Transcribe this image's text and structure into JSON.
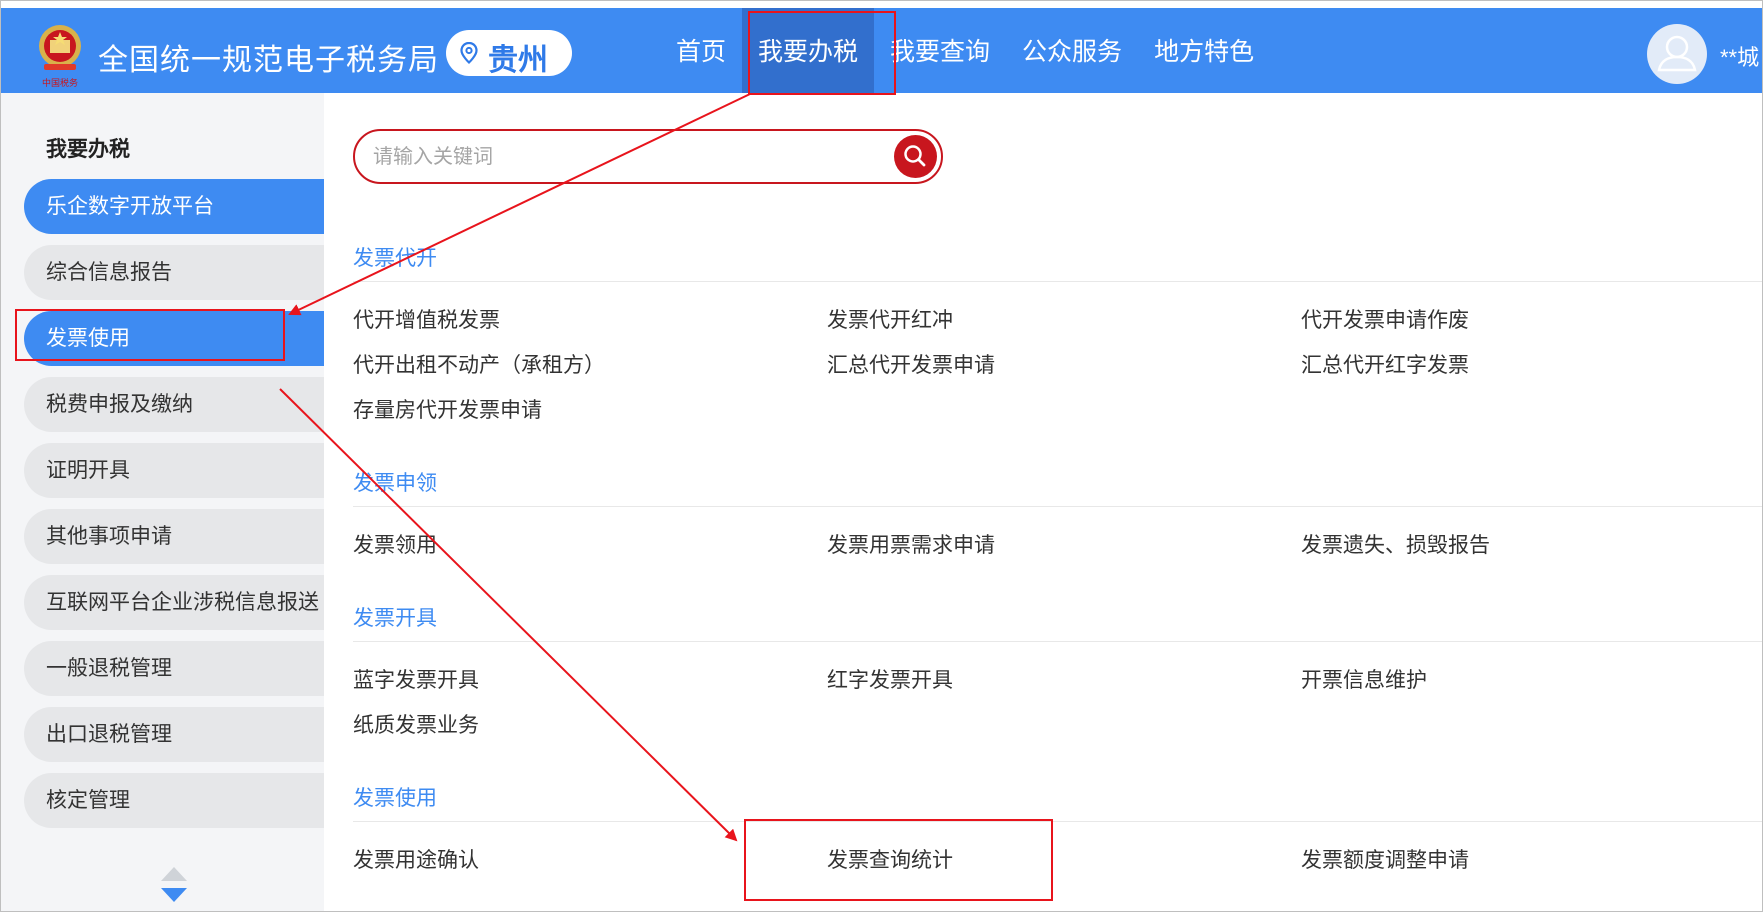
{
  "header": {
    "site_title": "全国统一规范电子税务局",
    "region": "贵州",
    "emblem_caption": "中国税务",
    "nav": [
      {
        "label": "首页",
        "active": false
      },
      {
        "label": "我要办税",
        "active": true
      },
      {
        "label": "我要查询",
        "active": false
      },
      {
        "label": "公众服务",
        "active": false
      },
      {
        "label": "地方特色",
        "active": false
      }
    ],
    "user_name": "**城"
  },
  "sidebar": {
    "heading": "我要办税",
    "items": [
      {
        "label": "乐企数字开放平台",
        "active": true
      },
      {
        "label": "综合信息报告",
        "active": false
      },
      {
        "label": "发票使用",
        "active": true
      },
      {
        "label": "税费申报及缴纳",
        "active": false
      },
      {
        "label": "证明开具",
        "active": false
      },
      {
        "label": "其他事项申请",
        "active": false
      },
      {
        "label": "互联网平台企业涉税信息报送",
        "active": false
      },
      {
        "label": "一般退税管理",
        "active": false
      },
      {
        "label": "出口退税管理",
        "active": false
      },
      {
        "label": "核定管理",
        "active": false
      }
    ]
  },
  "search": {
    "placeholder": "请输入关键词",
    "value": ""
  },
  "sections": [
    {
      "title": "发票代开",
      "links": [
        "代开增值税发票",
        "发票代开红冲",
        "代开发票申请作废",
        "代开出租不动产（承租方）",
        "汇总代开发票申请",
        "汇总代开红字发票",
        "存量房代开发票申请"
      ]
    },
    {
      "title": "发票申领",
      "links": [
        "发票领用",
        "发票用票需求申请",
        "发票遗失、损毁报告"
      ]
    },
    {
      "title": "发票开具",
      "links": [
        "蓝字发票开具",
        "红字发票开具",
        "开票信息维护",
        "纸质发票业务"
      ]
    },
    {
      "title": "发票使用",
      "links": [
        "发票用途确认",
        "发票查询统计",
        "发票额度调整申请"
      ]
    }
  ],
  "colors": {
    "header_blue": "#3e8bf2",
    "nav_active": "#326fcd",
    "section_blue": "#3e8bf2",
    "search_red": "#c8161e",
    "annotation_red": "#e8141c"
  },
  "icons": {
    "emblem": "national-tax-emblem-icon",
    "pin": "location-pin-icon",
    "avatar": "user-avatar-icon",
    "search": "search-icon",
    "scroll": "scroll-up-down-icon"
  }
}
